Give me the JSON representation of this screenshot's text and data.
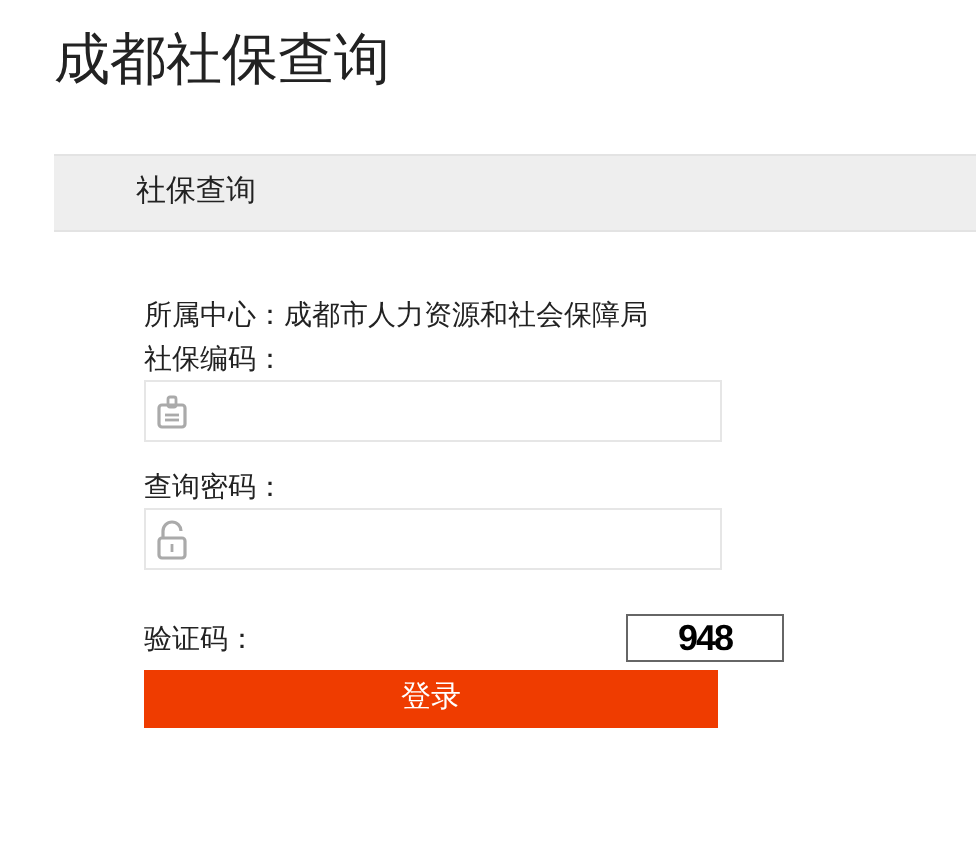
{
  "page_title": "成都社保查询",
  "section_title": "社保查询",
  "center": "所属中心：成都市人力资源和社会保障局",
  "fields": [
    {
      "label": "社保编码：",
      "kind": "id"
    },
    {
      "label": "查询密码：",
      "kind": "password"
    }
  ],
  "captcha": {
    "label": "验证码：",
    "code": "948"
  },
  "login_button": "登录"
}
